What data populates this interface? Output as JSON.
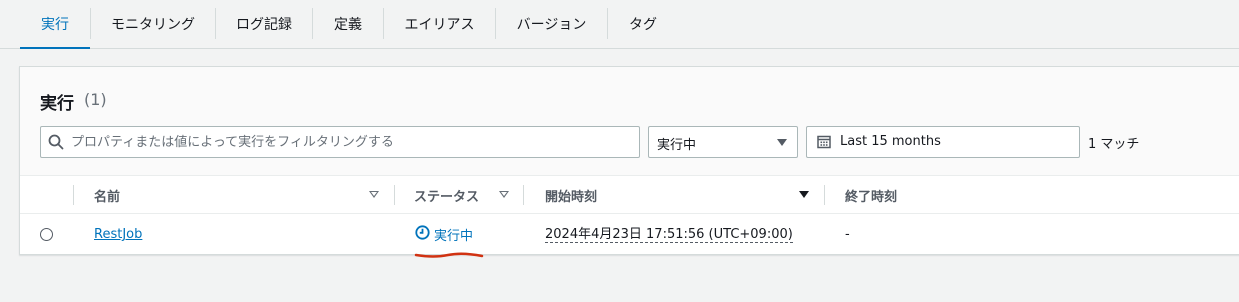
{
  "tabs": [
    {
      "label": "実行",
      "active": true
    },
    {
      "label": "モニタリング"
    },
    {
      "label": "ログ記録"
    },
    {
      "label": "定義"
    },
    {
      "label": "エイリアス"
    },
    {
      "label": "バージョン"
    },
    {
      "label": "タグ"
    }
  ],
  "panel": {
    "title": "実行",
    "count": "(1)",
    "search_placeholder": "プロパティまたは値によって実行をフィルタリングする",
    "status_filter": "実行中",
    "date_range": "Last 15 months",
    "match_count": "1 マッチ"
  },
  "table": {
    "columns": [
      "名前",
      "ステータス",
      "開始時刻",
      "終了時刻"
    ],
    "rows": [
      {
        "name": "RestJob",
        "status": "実行中",
        "start_time": "2024年4月23日 17:51:56 (UTC+09:00)",
        "end_time": "-"
      }
    ]
  },
  "colors": {
    "accent": "#0073bb",
    "annotation": "#d13212"
  },
  "icons": {
    "search": "search-icon",
    "calendar": "calendar-icon",
    "status_running": "clock-icon"
  }
}
